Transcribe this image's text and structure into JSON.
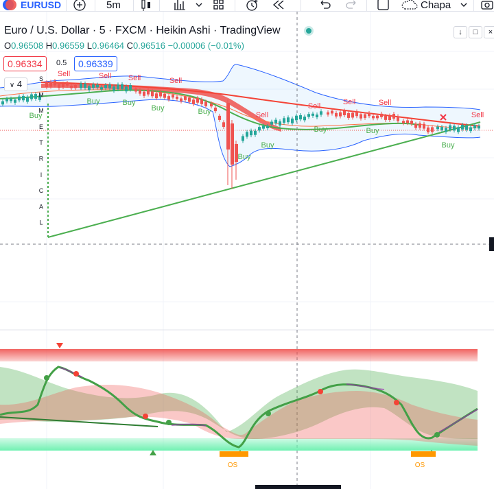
{
  "toolbar": {
    "symbol": "EURUSD",
    "interval": "5m",
    "add_symbol_icon": "plus-circle-icon",
    "chart_type_icon": "candles-icon",
    "indicators_icon": "indicators-icon",
    "layout_icon": "layout-grid-icon",
    "alert_icon": "alert-add-icon",
    "replay_icon": "replay-icon",
    "undo_icon": "undo-icon",
    "redo_icon": "redo-icon",
    "layout_name": "Chapa",
    "cloud_icon": "cloud-icon"
  },
  "legend": {
    "title": "Euro / U.S. Dollar · 5 · FXCM · Heikin Ashi · TradingView",
    "open_label": "O",
    "open": "0.96508",
    "high_label": "H",
    "high": "0.96559",
    "low_label": "L",
    "low": "0.96464",
    "close_label": "C",
    "close": "0.96516",
    "change": "−0.00006 (−0.01%)",
    "sell_price": "0.96334",
    "spread": "0.5",
    "buy_price": "0.96339",
    "indicators_count": "4"
  },
  "signals": {
    "buy_label": "Buy",
    "sell_label": "Sell",
    "os_label": "OS",
    "vertical_text": "SMMETRICAL"
  },
  "colors": {
    "bull": "#26a69a",
    "bear": "#ef5350",
    "buy_text": "#4caf50",
    "sell_text": "#f23645",
    "band": "#2962ff",
    "os_box": "#ff9800"
  }
}
